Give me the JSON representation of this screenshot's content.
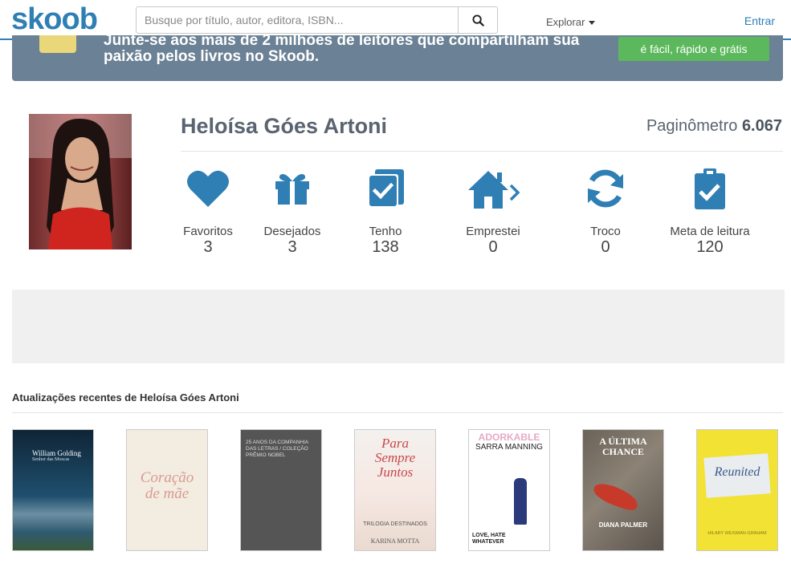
{
  "header": {
    "logo": "skoob",
    "search_placeholder": "Busque por título, autor, editora, ISBN...",
    "explore_label": "Explorar",
    "login_label": "Entrar"
  },
  "banner": {
    "line1": "Junte-se aos mais de 2 milhões de leitores que compartilham sua",
    "line2": "paixão pelos livros no Skoob.",
    "button_label": "é fácil, rápido e grátis"
  },
  "profile": {
    "name": "Heloísa Góes Artoni",
    "paginometro_label": "Paginômetro",
    "paginometro_value": "6.067"
  },
  "stats": [
    {
      "label": "Favoritos",
      "count": "3",
      "icon": "heart-icon"
    },
    {
      "label": "Desejados",
      "count": "3",
      "icon": "gift-icon"
    },
    {
      "label": "Tenho",
      "count": "138",
      "icon": "books-check-icon"
    },
    {
      "label": "Emprestei",
      "count": "0",
      "icon": "house-arrow-icon"
    },
    {
      "label": "Troco",
      "count": "0",
      "icon": "refresh-icon"
    },
    {
      "label": "Meta de leitura",
      "count": "120",
      "icon": "clipboard-check-icon"
    }
  ],
  "updates": {
    "title": "Atualizações recentes de Heloísa Góes Artoni",
    "books": [
      {
        "title": "Senhor das Moscas",
        "author": "William Golding"
      },
      {
        "title": "Coração de mãe",
        "author": ""
      },
      {
        "title": "25 ANOS DA COMPANHIA DAS LETRAS / COLEÇÃO PRÊMIO NOBEL",
        "author": ""
      },
      {
        "title": "Para Sempre Juntos",
        "subtitle": "TRILOGIA DESTINADOS",
        "author": "KARINA MOTTA"
      },
      {
        "title": "ADORKABLE",
        "author": "SARRA MANNING",
        "tagline": "LOVE, HATE WHATEVER"
      },
      {
        "title": "A ÚLTIMA CHANCE",
        "author": "DIANA PALMER"
      },
      {
        "title": "Reunited",
        "author": "HILARY WEISMAN GRAHAM"
      }
    ]
  },
  "colors": {
    "brand": "#2f7fb5",
    "banner": "#6b8195",
    "cta": "#5cb85c",
    "icon": "#2f7fb5"
  }
}
